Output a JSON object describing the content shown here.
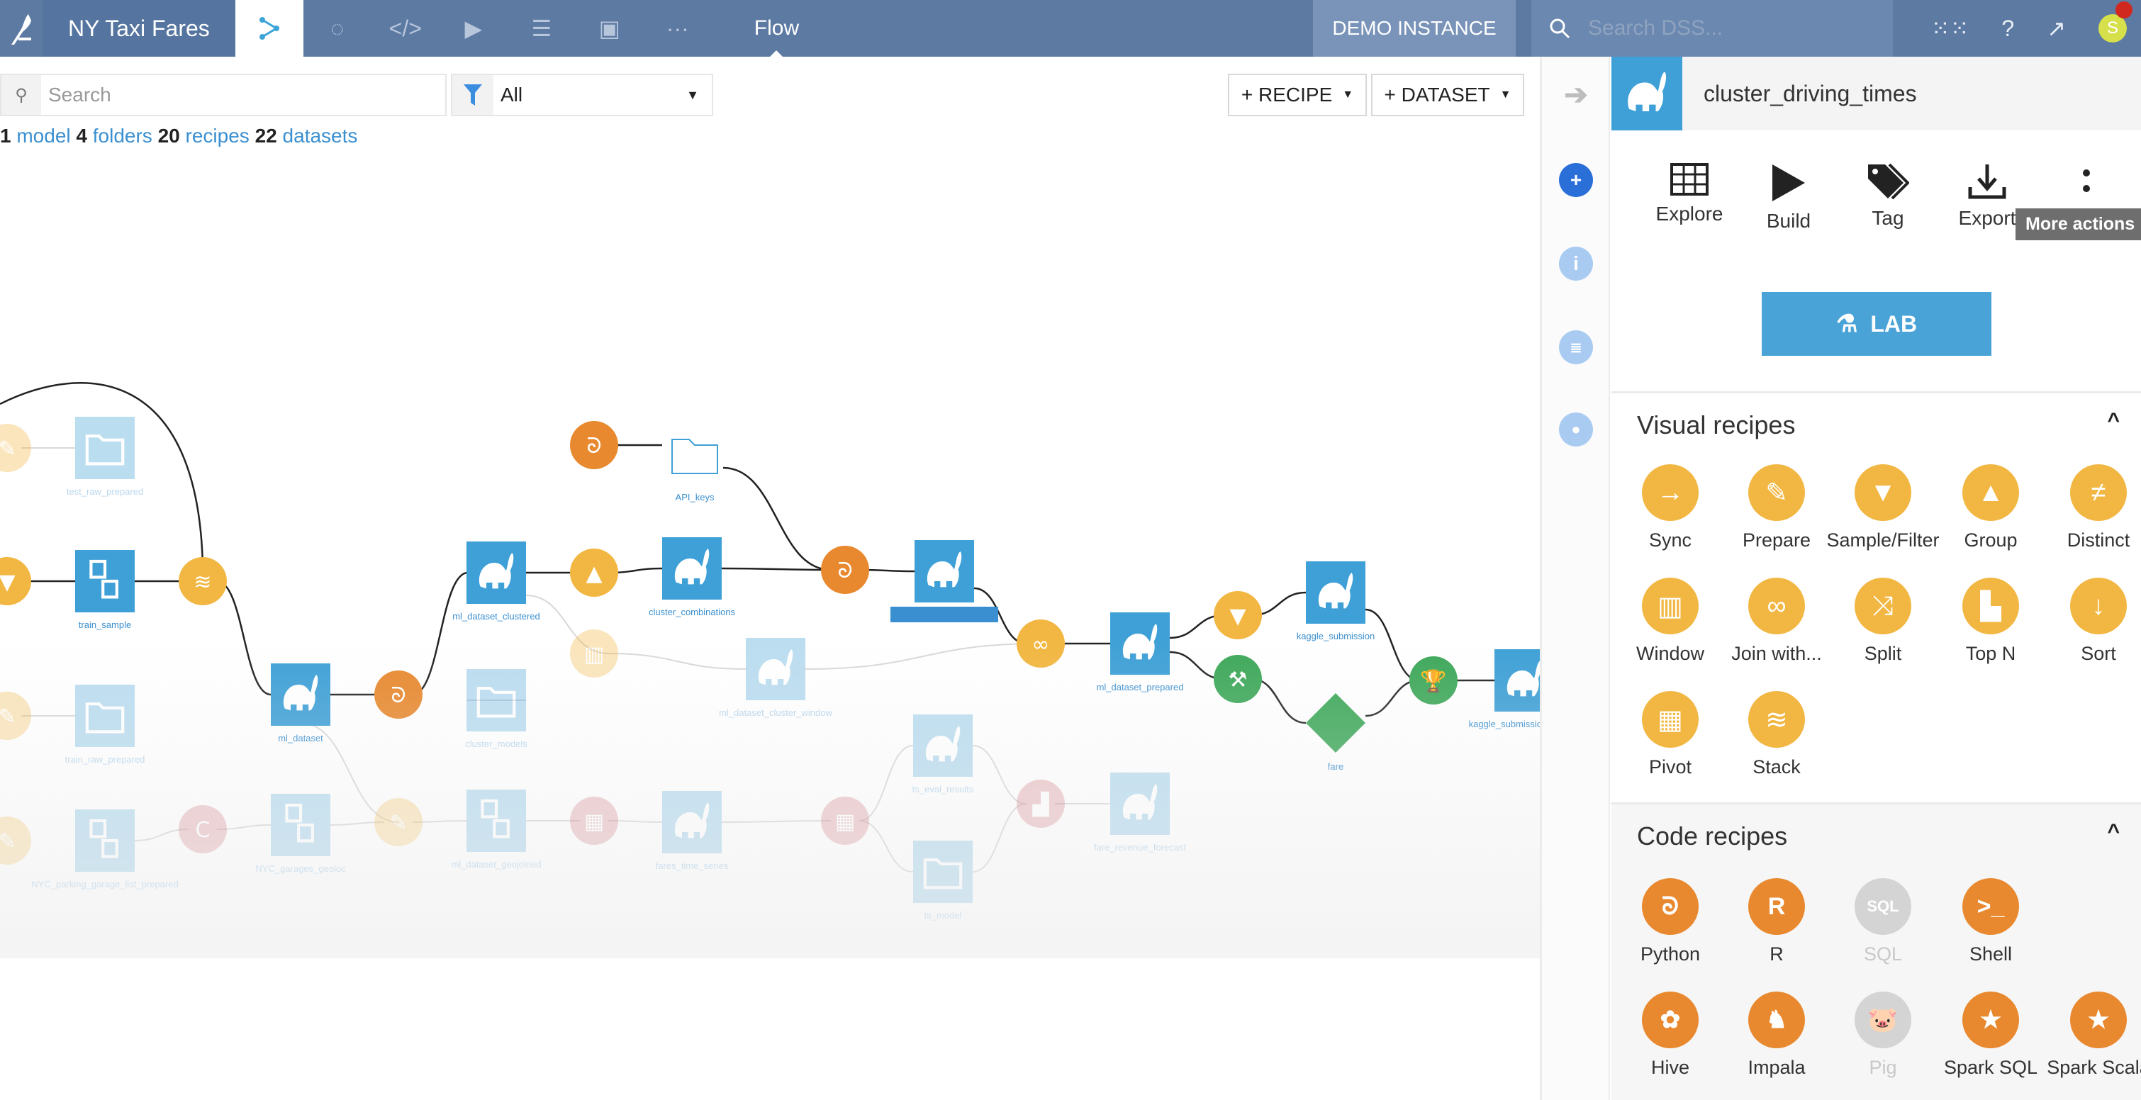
{
  "topbar": {
    "project_title": "NY Taxi Fares",
    "nav_icons": [
      "flow-icon",
      "analysis-icon",
      "code-icon",
      "run-icon",
      "library-icon",
      "dashboard-icon",
      "more-icon"
    ],
    "current_section": "Flow",
    "instance_label": "DEMO INSTANCE",
    "search_placeholder": "Search DSS...",
    "avatar_initial": "S"
  },
  "toolbar": {
    "search_placeholder": "Search",
    "filter_value": "All",
    "add_recipe_label": "+ RECIPE",
    "add_dataset_label": "+ DATASET",
    "stats": [
      {
        "count": "1",
        "label": "model"
      },
      {
        "count": "4",
        "label": "folders"
      },
      {
        "count": "20",
        "label": "recipes"
      },
      {
        "count": "22",
        "label": "datasets"
      }
    ]
  },
  "flow": {
    "nodes": [
      {
        "label": "test_raw_prepared",
        "kind": "folder",
        "faded": true
      },
      {
        "label": "train_sample",
        "kind": "dataset",
        "faded": false
      },
      {
        "label": "train_raw_prepared",
        "kind": "folder",
        "faded": true
      },
      {
        "label": "ml_dataset",
        "kind": "dataset",
        "faded": false
      },
      {
        "label": "ml_dataset_clustered",
        "kind": "dataset",
        "faded": false
      },
      {
        "label": "API_keys",
        "kind": "folder",
        "faded": false
      },
      {
        "label": "cluster_combinations",
        "kind": "dataset",
        "faded": false
      },
      {
        "label": "cluster_driving_times",
        "kind": "dataset",
        "faded": false,
        "selected": true
      },
      {
        "label": "cluster_models",
        "kind": "folder",
        "faded": true
      },
      {
        "label": "ml_dataset_cluster_window",
        "kind": "dataset",
        "faded": true
      },
      {
        "label": "ml_dataset_prepared",
        "kind": "dataset",
        "faded": false
      },
      {
        "label": "kaggle_submission",
        "kind": "dataset",
        "faded": false
      },
      {
        "label": "fare",
        "kind": "model",
        "faded": false
      },
      {
        "label": "kaggle_submission_scored",
        "kind": "dataset",
        "faded": false
      },
      {
        "label": "NYC_parking_garage_list_prepared",
        "kind": "dataset",
        "faded": true
      },
      {
        "label": "NYC_garages_geoloc",
        "kind": "dataset",
        "faded": true
      },
      {
        "label": "ml_dataset_geojoined",
        "kind": "dataset",
        "faded": true
      },
      {
        "label": "fares_time_series",
        "kind": "dataset",
        "faded": true
      },
      {
        "label": "ts_eval_results",
        "kind": "dataset",
        "faded": true
      },
      {
        "label": "ts_model",
        "kind": "folder",
        "faded": true
      },
      {
        "label": "fare_revenue_forecast",
        "kind": "dataset",
        "faded": true
      }
    ]
  },
  "sidebar": {
    "collapse_icon": "arrow-right-icon",
    "tabs": [
      "actions-tab",
      "info-tab",
      "schema-tab",
      "discussions-tab"
    ]
  },
  "panel": {
    "title": "cluster_driving_times",
    "actions": [
      {
        "label": "Explore",
        "icon": "table-icon"
      },
      {
        "label": "Build",
        "icon": "play-icon"
      },
      {
        "label": "Tag",
        "icon": "tag-icon"
      },
      {
        "label": "Export",
        "icon": "download-icon"
      }
    ],
    "more_tooltip": "More actions",
    "lab_label": "LAB",
    "visual_title": "Visual recipes",
    "visual_recipes": [
      {
        "label": "Sync"
      },
      {
        "label": "Prepare"
      },
      {
        "label": "Sample/Filter"
      },
      {
        "label": "Group"
      },
      {
        "label": "Distinct"
      },
      {
        "label": "Window"
      },
      {
        "label": "Join with..."
      },
      {
        "label": "Split"
      },
      {
        "label": "Top N"
      },
      {
        "label": "Sort"
      },
      {
        "label": "Pivot"
      },
      {
        "label": "Stack"
      }
    ],
    "code_title": "Code recipes",
    "code_recipes": [
      {
        "label": "Python",
        "enabled": true
      },
      {
        "label": "R",
        "enabled": true
      },
      {
        "label": "SQL",
        "enabled": false
      },
      {
        "label": "Shell",
        "enabled": true
      },
      {
        "label": "Hive",
        "enabled": true
      },
      {
        "label": "Impala",
        "enabled": true
      },
      {
        "label": "Pig",
        "enabled": false
      },
      {
        "label": "Spark SQL",
        "enabled": true
      },
      {
        "label": "Spark Scala",
        "enabled": true
      }
    ],
    "colors": {
      "visual": "#f2b742",
      "code": "#e8892f",
      "disabled": "#d4d4d4",
      "dataset": "#3ea0d6",
      "ml": "#3ea85a"
    }
  }
}
